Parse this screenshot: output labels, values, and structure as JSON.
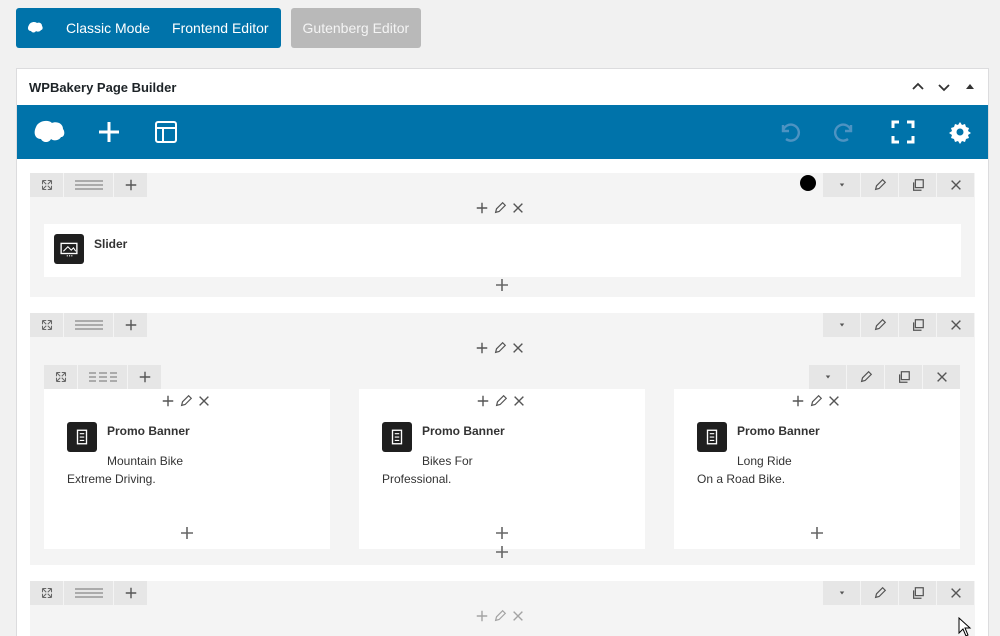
{
  "topbar": {
    "classic_label": "Classic Mode",
    "frontend_label": "Frontend Editor",
    "gutenberg_label": "Gutenberg Editor",
    "accent": "#0073aa",
    "disabled_color": "#b9b9b9"
  },
  "panel": {
    "title": "WPBakery Page Builder"
  },
  "toolbar": {
    "icons": [
      "wpbakery-logo-icon",
      "add-element-icon",
      "templates-icon",
      "undo-icon",
      "redo-icon",
      "fullscreen-icon",
      "settings-icon"
    ]
  },
  "rows": {
    "row1": {
      "element_title": "Slider"
    },
    "row2": {
      "columns": [
        {
          "title": "Promo Banner",
          "line1": "Mountain Bike",
          "line2": "Extreme Driving."
        },
        {
          "title": "Promo Banner",
          "line1": "Bikes For",
          "line2": "Professional."
        },
        {
          "title": "Promo Banner",
          "line1": "Long Ride",
          "line2": "On a Road Bike."
        }
      ]
    }
  }
}
